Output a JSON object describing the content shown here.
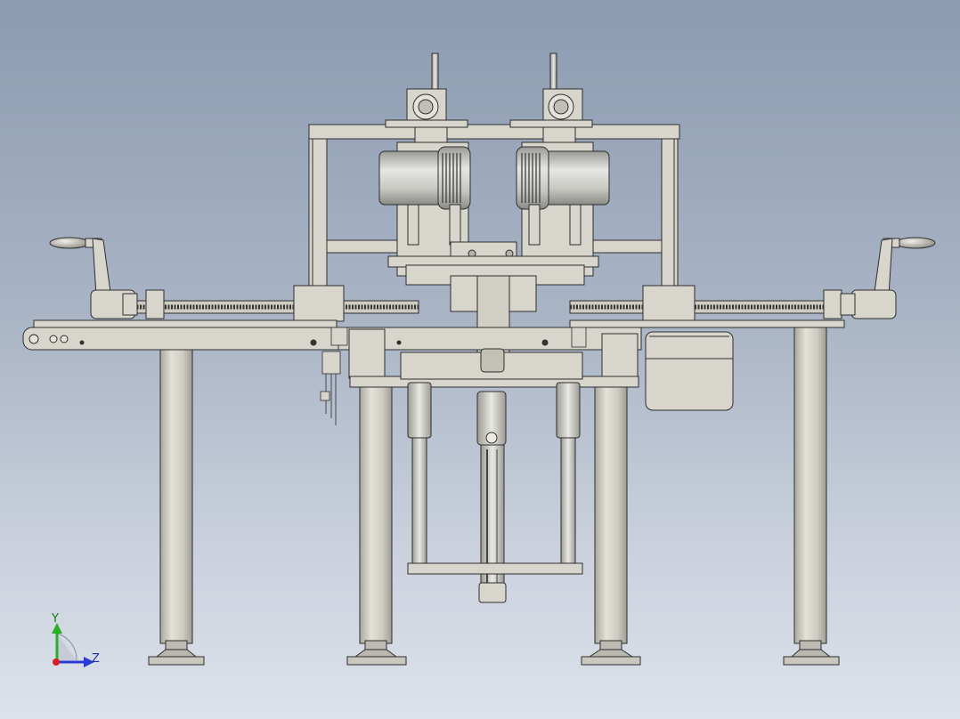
{
  "viewport": {
    "background_top": "#8c9bb1",
    "background_bottom": "#dde2ea",
    "part_color": "#d8d6cc",
    "edge_color": "#2e2e2e"
  },
  "triad": {
    "y_label": "Y",
    "z_label": "Z",
    "y_color": "#27b027",
    "z_color": "#2b3bd8",
    "x_color": "#d81f1f"
  }
}
